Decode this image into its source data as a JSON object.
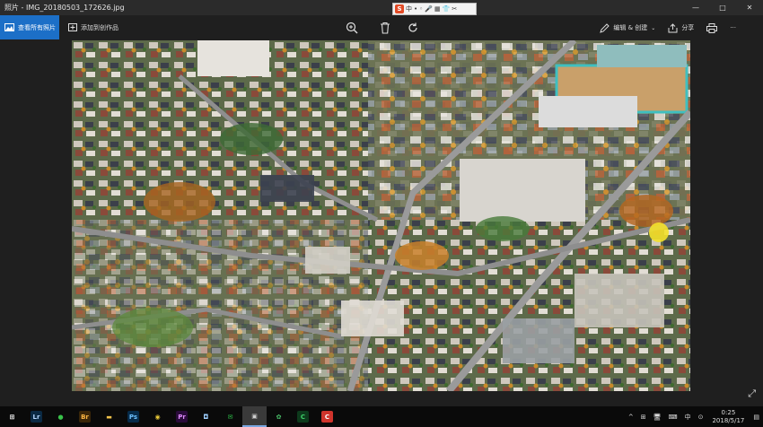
{
  "window": {
    "title": "照片 - IMG_20180503_172626.jpg",
    "controls": [
      "—",
      "□",
      "✕"
    ]
  },
  "ime": {
    "logo": "S",
    "lang": "中",
    "items": [
      "中",
      "•",
      "◦",
      "🎤",
      "▦",
      "👕",
      "✂"
    ]
  },
  "toolbar": {
    "view_all_label": "查看所有照片",
    "add_to_creation_label": "添加到创作品",
    "edit_create_label": "编辑 & 创建",
    "share_label": "分享"
  },
  "taskbar": {
    "apps": [
      {
        "name": "start",
        "glyph": "⊞",
        "color": "#ffffff",
        "bg": "transparent"
      },
      {
        "name": "lightroom",
        "glyph": "Lr",
        "color": "#b6d8ff",
        "bg": "#0b2a44"
      },
      {
        "name": "app-green",
        "glyph": "●",
        "color": "#39c24a",
        "bg": "transparent"
      },
      {
        "name": "bridge",
        "glyph": "Br",
        "color": "#ffb642",
        "bg": "#3a2608"
      },
      {
        "name": "file-explorer",
        "glyph": "▬",
        "color": "#f1c24a",
        "bg": "transparent"
      },
      {
        "name": "photoshop",
        "glyph": "Ps",
        "color": "#6ec1ff",
        "bg": "#062b4a"
      },
      {
        "name": "chrome",
        "glyph": "◉",
        "color": "#e8c838",
        "bg": "transparent"
      },
      {
        "name": "premiere",
        "glyph": "Pr",
        "color": "#e08cff",
        "bg": "#2a0b3a"
      },
      {
        "name": "app-white",
        "glyph": "◘",
        "color": "#9fd0ff",
        "bg": "transparent"
      },
      {
        "name": "wechat",
        "glyph": "✉",
        "color": "#2fc24a",
        "bg": "transparent"
      },
      {
        "name": "photos",
        "glyph": "▣",
        "color": "#cfcfcf",
        "bg": "transparent"
      },
      {
        "name": "app-colorful",
        "glyph": "✿",
        "color": "#4ac26a",
        "bg": "transparent"
      },
      {
        "name": "camtasia",
        "glyph": "C",
        "color": "#3fd06a",
        "bg": "#0d3a1c"
      },
      {
        "name": "app-red",
        "glyph": "C",
        "color": "#ffffff",
        "bg": "#d0342c"
      }
    ],
    "tray": {
      "chevron": "^",
      "items": [
        "⊞",
        "🖥",
        "⌨",
        "中",
        "⊙"
      ],
      "time": "0:25",
      "date": "2018/5/17",
      "notification": "▤"
    }
  }
}
